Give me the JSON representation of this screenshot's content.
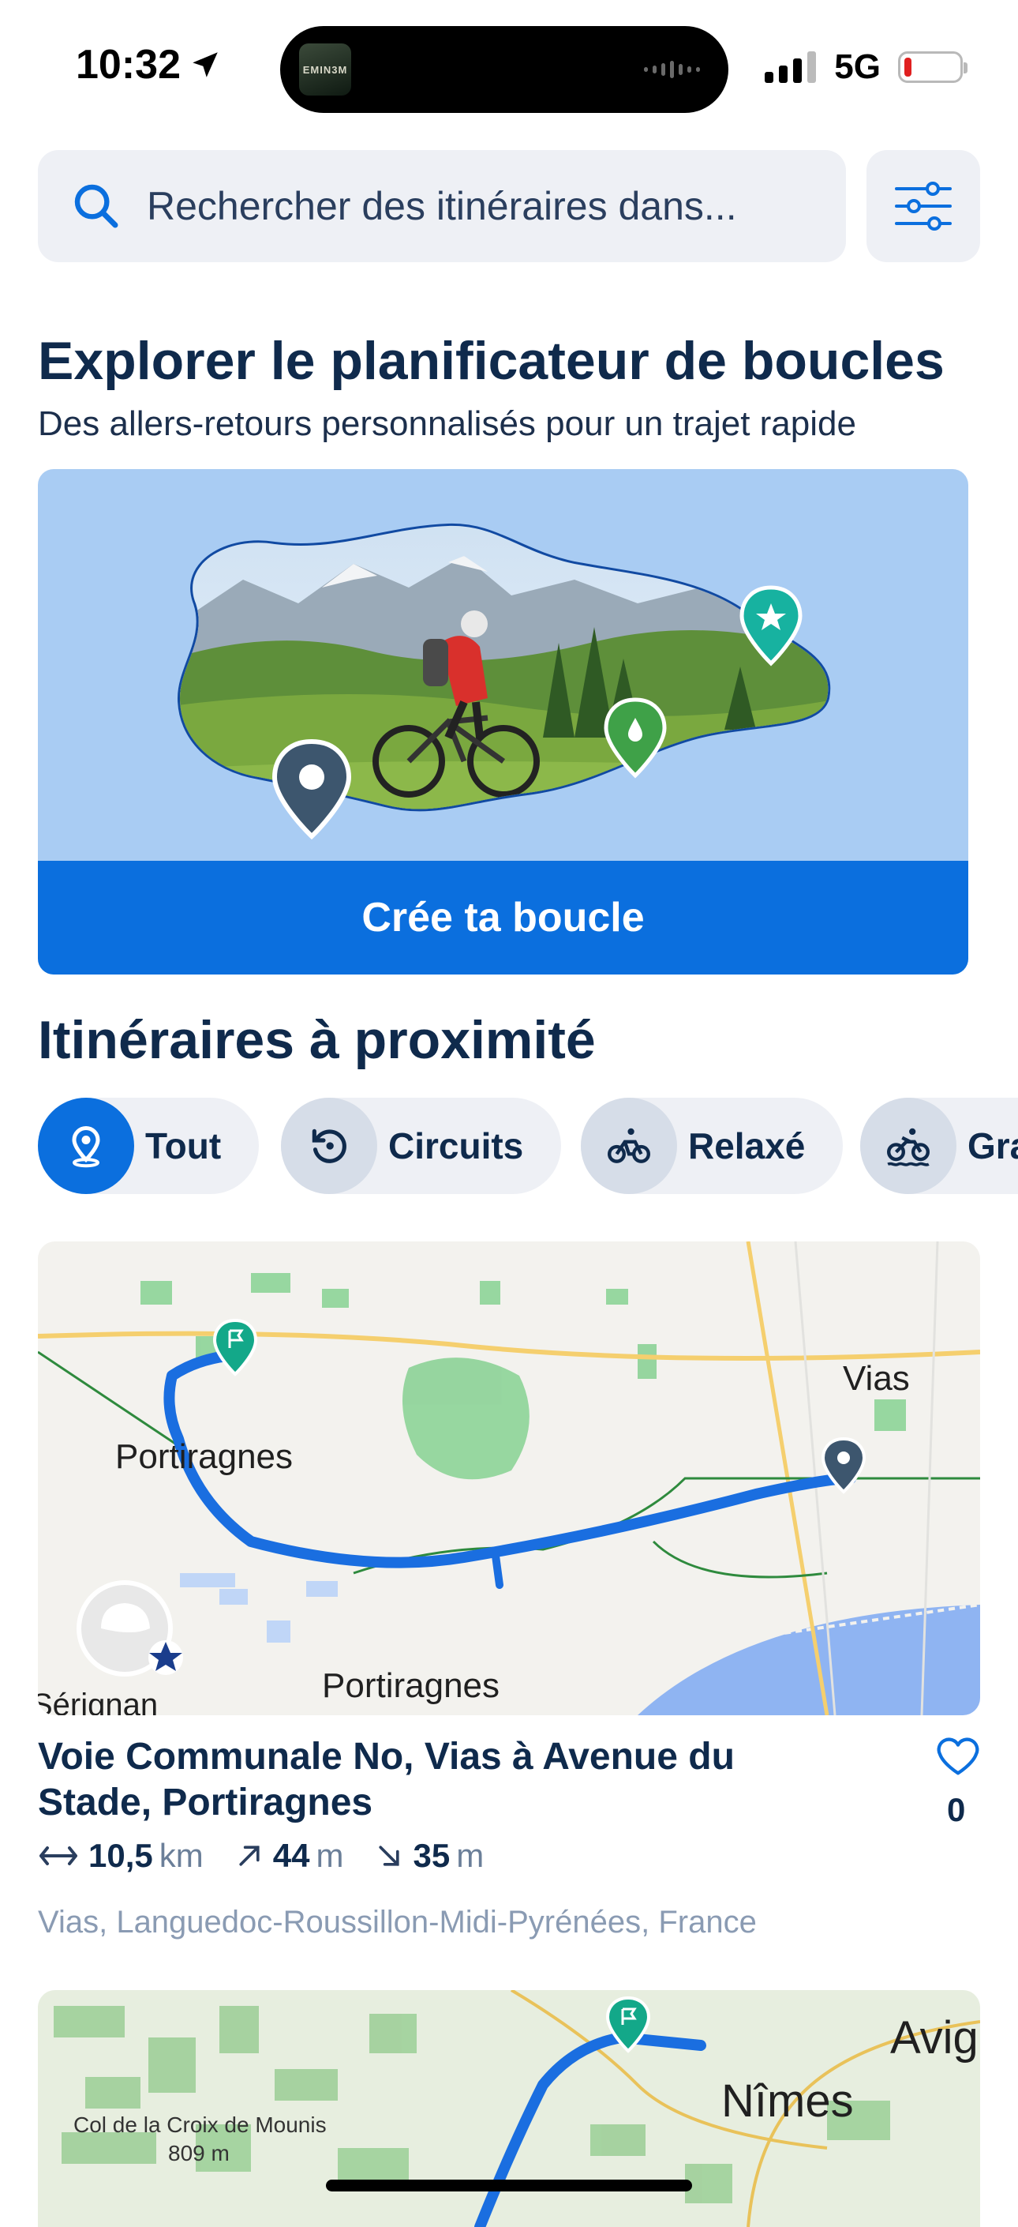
{
  "status": {
    "time": "10:32",
    "network": "5G",
    "now_playing_art": "EMIN3M",
    "battery_level": 0.1
  },
  "search": {
    "placeholder": "Rechercher des itinéraires dans..."
  },
  "loop_planner": {
    "title": "Explorer le planificateur de boucles",
    "subtitle": "Des allers-retours personnalisés pour un trajet rapide",
    "cta": "Crée ta boucle"
  },
  "nearby": {
    "title": "Itinéraires à proximité",
    "chips": [
      {
        "label": "Tout",
        "icon": "location-pin-icon",
        "active": true
      },
      {
        "label": "Circuits",
        "icon": "loop-arrow-icon",
        "active": false
      },
      {
        "label": "Relaxé",
        "icon": "bike-relaxed-icon",
        "active": false
      },
      {
        "label": "Gra",
        "icon": "bike-gravel-icon",
        "active": false
      }
    ]
  },
  "route1": {
    "title": "Voie Communale No, Vias à Avenue du Stade, Portiragnes",
    "distance": "10,5",
    "distance_unit": "km",
    "ascent": "44",
    "ascent_unit": "m",
    "descent": "35",
    "descent_unit": "m",
    "location": "Vias, Languedoc-Roussillon-Midi-Pyrénées, France",
    "likes": "0",
    "map_labels": {
      "town_a": "Portiragnes",
      "town_b": "Vias",
      "town_c": "Portiragnes",
      "town_d": "Sérignan"
    }
  },
  "route2": {
    "map_labels": {
      "peak": "Col de la Croix de Mounis",
      "peak_alt": "809 m",
      "city": "Nîmes",
      "city2": "Avig"
    }
  },
  "colors": {
    "accent": "#0b6fde",
    "heading": "#0f2a4c",
    "route": "#1a6ee0",
    "start_pin": "#13a889"
  }
}
